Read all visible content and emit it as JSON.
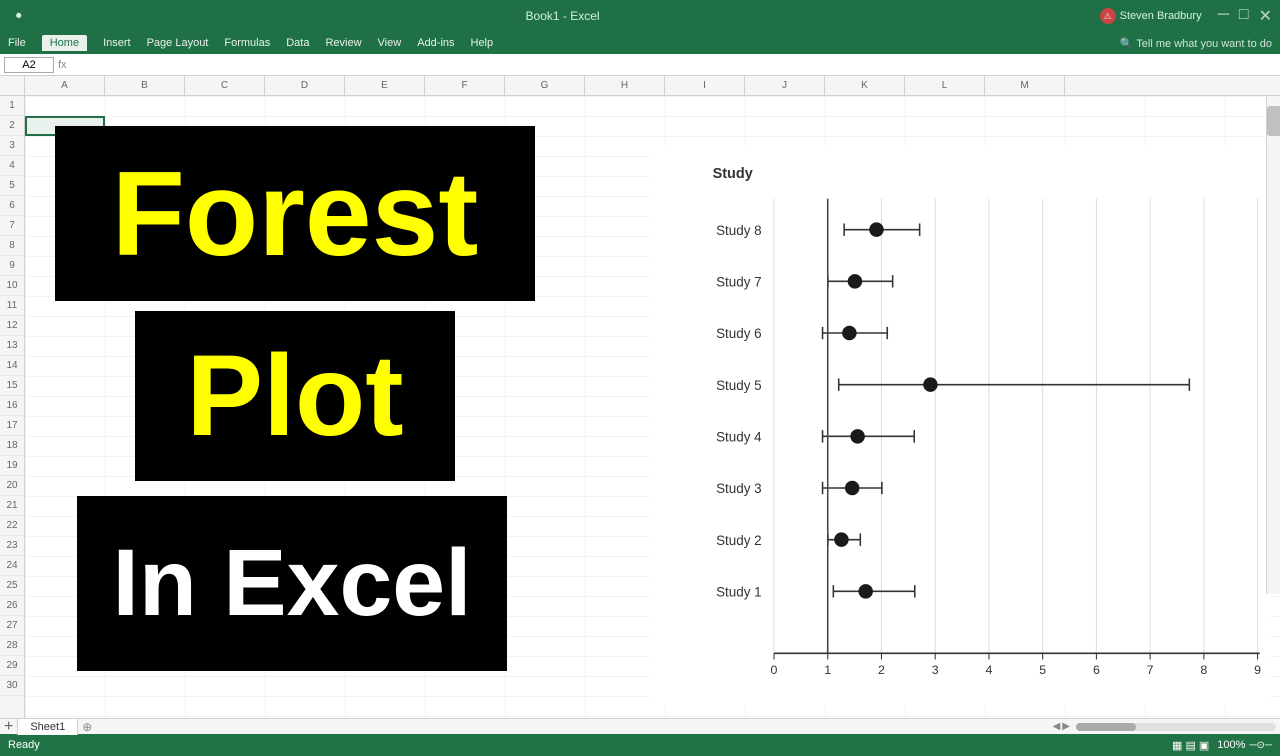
{
  "window": {
    "title": "Book1 - Excel",
    "user": "Steven Bradbury",
    "tabs": [
      "File",
      "Home",
      "Insert",
      "Page Layout",
      "Formulas",
      "Data",
      "Review",
      "View",
      "Add-ins",
      "Help"
    ]
  },
  "formula_bar": {
    "cell_ref": "A2",
    "formula": ""
  },
  "title_blocks": {
    "line1": "Forest",
    "line2": "Plot",
    "line3": "In Excel"
  },
  "chart": {
    "title": "Study",
    "x_axis": {
      "min": 0,
      "max": 9,
      "ticks": [
        0,
        1,
        2,
        3,
        4,
        5,
        6,
        7,
        8,
        9
      ]
    },
    "studies": [
      {
        "name": "Study 8",
        "point": 1.9,
        "low": 1.3,
        "high": 2.7
      },
      {
        "name": "Study 7",
        "point": 1.5,
        "low": 1.0,
        "high": 2.2
      },
      {
        "name": "Study 6",
        "point": 1.4,
        "low": 0.9,
        "high": 2.1
      },
      {
        "name": "Study 5",
        "point": 2.9,
        "low": 1.2,
        "high": 7.7
      },
      {
        "name": "Study 4",
        "point": 1.55,
        "low": 0.9,
        "high": 2.6
      },
      {
        "name": "Study 3",
        "point": 1.45,
        "low": 0.9,
        "high": 2.0
      },
      {
        "name": "Study 2",
        "point": 1.25,
        "low": 1.0,
        "high": 1.6
      },
      {
        "name": "Study 1",
        "point": 1.7,
        "low": 1.1,
        "high": 2.65
      }
    ]
  },
  "sheet_tabs": [
    "Sheet1"
  ],
  "status": "Ready",
  "colors": {
    "excel_green": "#1f7145",
    "title_yellow": "#ffff00",
    "title_bg": "#000000"
  }
}
